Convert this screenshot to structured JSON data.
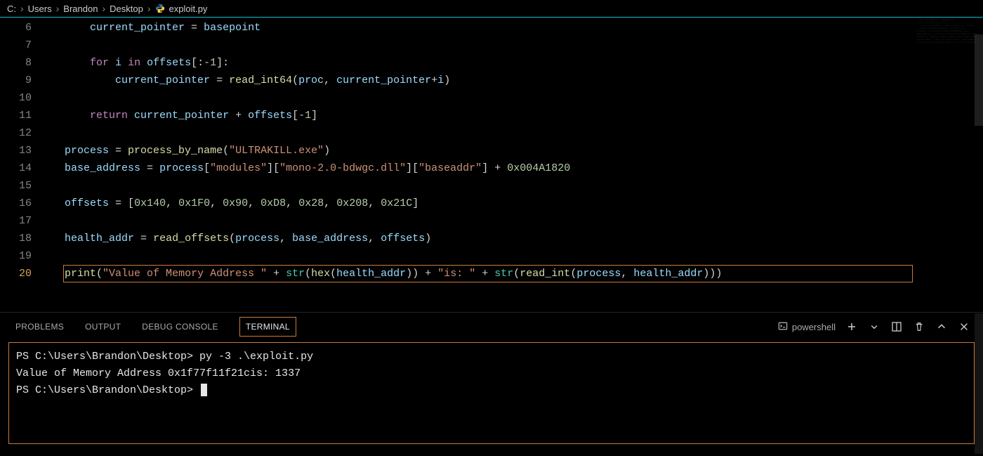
{
  "breadcrumb": {
    "parts": [
      "C:",
      "Users",
      "Brandon",
      "Desktop"
    ],
    "file": "exploit.py"
  },
  "editor": {
    "active_line": 20,
    "lines": [
      {
        "num": 6,
        "indent": 2,
        "tokens": [
          [
            "id",
            "current_pointer"
          ],
          [
            "op",
            " = "
          ],
          [
            "id",
            "basepoint"
          ]
        ]
      },
      {
        "num": 7,
        "indent": 0,
        "tokens": []
      },
      {
        "num": 8,
        "indent": 2,
        "tokens": [
          [
            "kw",
            "for"
          ],
          [
            "default",
            " "
          ],
          [
            "id",
            "i"
          ],
          [
            "default",
            " "
          ],
          [
            "kw",
            "in"
          ],
          [
            "default",
            " "
          ],
          [
            "id",
            "offsets"
          ],
          [
            "punct",
            "[:"
          ],
          [
            "num",
            "-1"
          ],
          [
            "punct",
            "]:"
          ]
        ]
      },
      {
        "num": 9,
        "indent": 3,
        "tokens": [
          [
            "id",
            "current_pointer"
          ],
          [
            "op",
            " = "
          ],
          [
            "fn",
            "read_int64"
          ],
          [
            "punct",
            "("
          ],
          [
            "id",
            "proc"
          ],
          [
            "punct",
            ", "
          ],
          [
            "id",
            "current_pointer"
          ],
          [
            "op",
            "+"
          ],
          [
            "id",
            "i"
          ],
          [
            "punct",
            ")"
          ]
        ]
      },
      {
        "num": 10,
        "indent": 0,
        "tokens": []
      },
      {
        "num": 11,
        "indent": 2,
        "tokens": [
          [
            "kw",
            "return"
          ],
          [
            "default",
            " "
          ],
          [
            "id",
            "current_pointer"
          ],
          [
            "op",
            " + "
          ],
          [
            "id",
            "offsets"
          ],
          [
            "punct",
            "["
          ],
          [
            "num",
            "-1"
          ],
          [
            "punct",
            "]"
          ]
        ]
      },
      {
        "num": 12,
        "indent": 0,
        "tokens": []
      },
      {
        "num": 13,
        "indent": 1,
        "tokens": [
          [
            "id",
            "process"
          ],
          [
            "op",
            " = "
          ],
          [
            "fn",
            "process_by_name"
          ],
          [
            "punct",
            "("
          ],
          [
            "str",
            "\"ULTRAKILL.exe\""
          ],
          [
            "punct",
            ")"
          ]
        ]
      },
      {
        "num": 14,
        "indent": 1,
        "tokens": [
          [
            "id",
            "base_address"
          ],
          [
            "op",
            " = "
          ],
          [
            "id",
            "process"
          ],
          [
            "punct",
            "["
          ],
          [
            "str",
            "\"modules\""
          ],
          [
            "punct",
            "]["
          ],
          [
            "str",
            "\"mono-2.0-bdwgc.dll\""
          ],
          [
            "punct",
            "]["
          ],
          [
            "str",
            "\"baseaddr\""
          ],
          [
            "punct",
            "]"
          ],
          [
            "op",
            " + "
          ],
          [
            "num",
            "0x004A1820"
          ]
        ]
      },
      {
        "num": 15,
        "indent": 0,
        "tokens": []
      },
      {
        "num": 16,
        "indent": 1,
        "tokens": [
          [
            "id",
            "offsets"
          ],
          [
            "op",
            " = "
          ],
          [
            "punct",
            "["
          ],
          [
            "num",
            "0x140"
          ],
          [
            "punct",
            ", "
          ],
          [
            "num",
            "0x1F0"
          ],
          [
            "punct",
            ", "
          ],
          [
            "num",
            "0x90"
          ],
          [
            "punct",
            ", "
          ],
          [
            "num",
            "0xD8"
          ],
          [
            "punct",
            ", "
          ],
          [
            "num",
            "0x28"
          ],
          [
            "punct",
            ", "
          ],
          [
            "num",
            "0x208"
          ],
          [
            "punct",
            ", "
          ],
          [
            "num",
            "0x21C"
          ],
          [
            "punct",
            "]"
          ]
        ]
      },
      {
        "num": 17,
        "indent": 0,
        "tokens": []
      },
      {
        "num": 18,
        "indent": 1,
        "tokens": [
          [
            "id",
            "health_addr"
          ],
          [
            "op",
            " = "
          ],
          [
            "fn",
            "read_offsets"
          ],
          [
            "punct",
            "("
          ],
          [
            "id",
            "process"
          ],
          [
            "punct",
            ", "
          ],
          [
            "id",
            "base_address"
          ],
          [
            "punct",
            ", "
          ],
          [
            "id",
            "offsets"
          ],
          [
            "punct",
            ")"
          ]
        ]
      },
      {
        "num": 19,
        "indent": 0,
        "tokens": []
      },
      {
        "num": 20,
        "indent": 1,
        "tokens": [
          [
            "fn",
            "print"
          ],
          [
            "punct",
            "("
          ],
          [
            "str",
            "\"Value of Memory Address \""
          ],
          [
            "op",
            " + "
          ],
          [
            "builtin",
            "str"
          ],
          [
            "punct",
            "("
          ],
          [
            "fn",
            "hex"
          ],
          [
            "punct",
            "("
          ],
          [
            "id",
            "health_addr"
          ],
          [
            "punct",
            "))"
          ],
          [
            "op",
            " + "
          ],
          [
            "str",
            "\"is: \""
          ],
          [
            "op",
            " + "
          ],
          [
            "builtin",
            "str"
          ],
          [
            "punct",
            "("
          ],
          [
            "fn",
            "read_int"
          ],
          [
            "punct",
            "("
          ],
          [
            "id",
            "process"
          ],
          [
            "punct",
            ", "
          ],
          [
            "id",
            "health_addr"
          ],
          [
            "punct",
            ")))"
          ]
        ]
      }
    ]
  },
  "panel": {
    "tabs": [
      "PROBLEMS",
      "OUTPUT",
      "DEBUG CONSOLE",
      "TERMINAL"
    ],
    "active_tab": 3,
    "shell_label": "powershell"
  },
  "terminal": {
    "lines": [
      {
        "prompt": "PS C:\\Users\\Brandon\\Desktop> ",
        "cmd": "py -3 .\\exploit.py"
      },
      {
        "text": "Value of Memory Address 0x1f77f11f21cis: 1337"
      },
      {
        "prompt": "PS C:\\Users\\Brandon\\Desktop> ",
        "cursor": true
      }
    ]
  }
}
